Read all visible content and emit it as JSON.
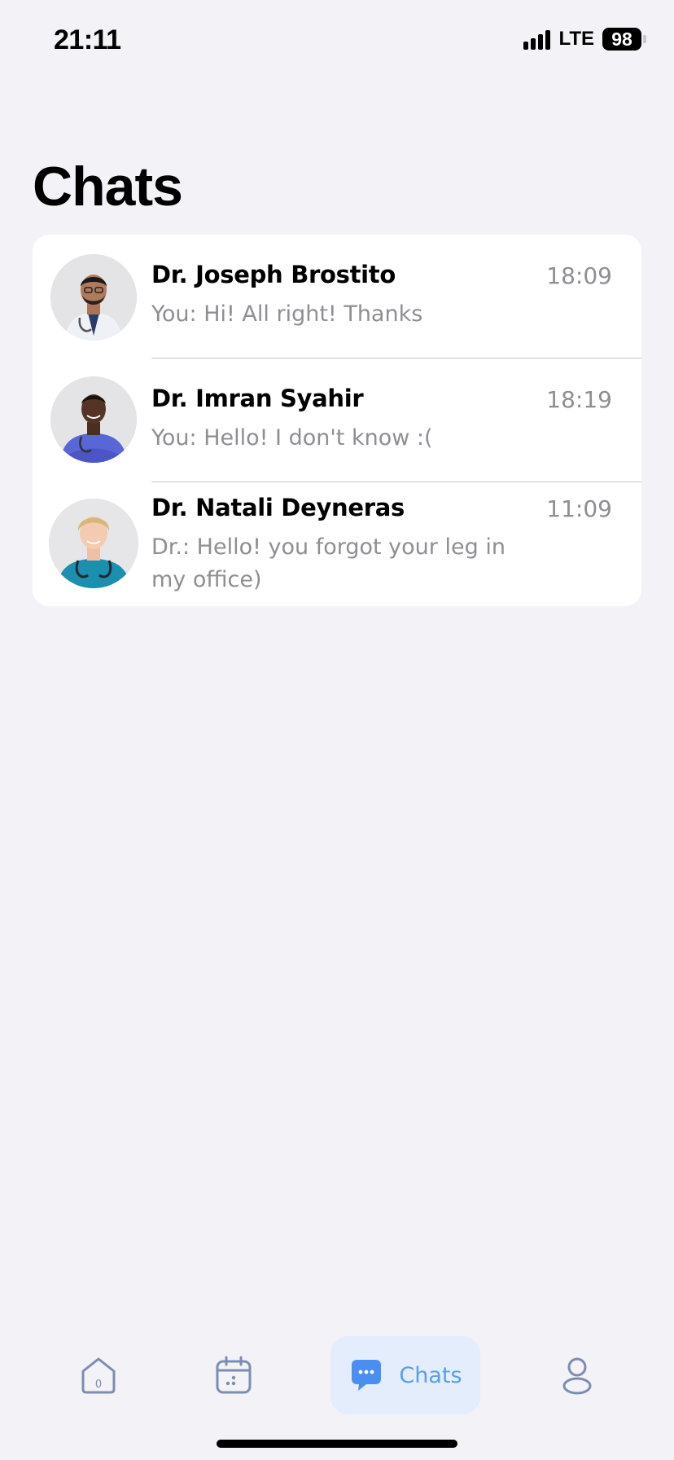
{
  "status": {
    "time": "21:11",
    "network": "LTE",
    "battery": "98"
  },
  "page": {
    "title": "Chats"
  },
  "chats": [
    {
      "name": "Dr. Joseph Brostito",
      "time": "18:09",
      "preview": "You: Hi! All right! Thanks",
      "avatar_icon": "doctor-avatar"
    },
    {
      "name": "Dr. Imran Syahir",
      "time": "18:19",
      "preview": "You: Hello! I don't know :(",
      "avatar_icon": "doctor-avatar"
    },
    {
      "name": "Dr. Natali Deyneras",
      "time": "11:09",
      "preview": "Dr.: Hello! you forgot your leg in my office)",
      "avatar_icon": "doctor-avatar"
    }
  ],
  "tabbar": {
    "home_badge": "0",
    "chats_label": "Chats",
    "active_color": "#5b9ded",
    "inactive_color": "#7d8db0"
  }
}
